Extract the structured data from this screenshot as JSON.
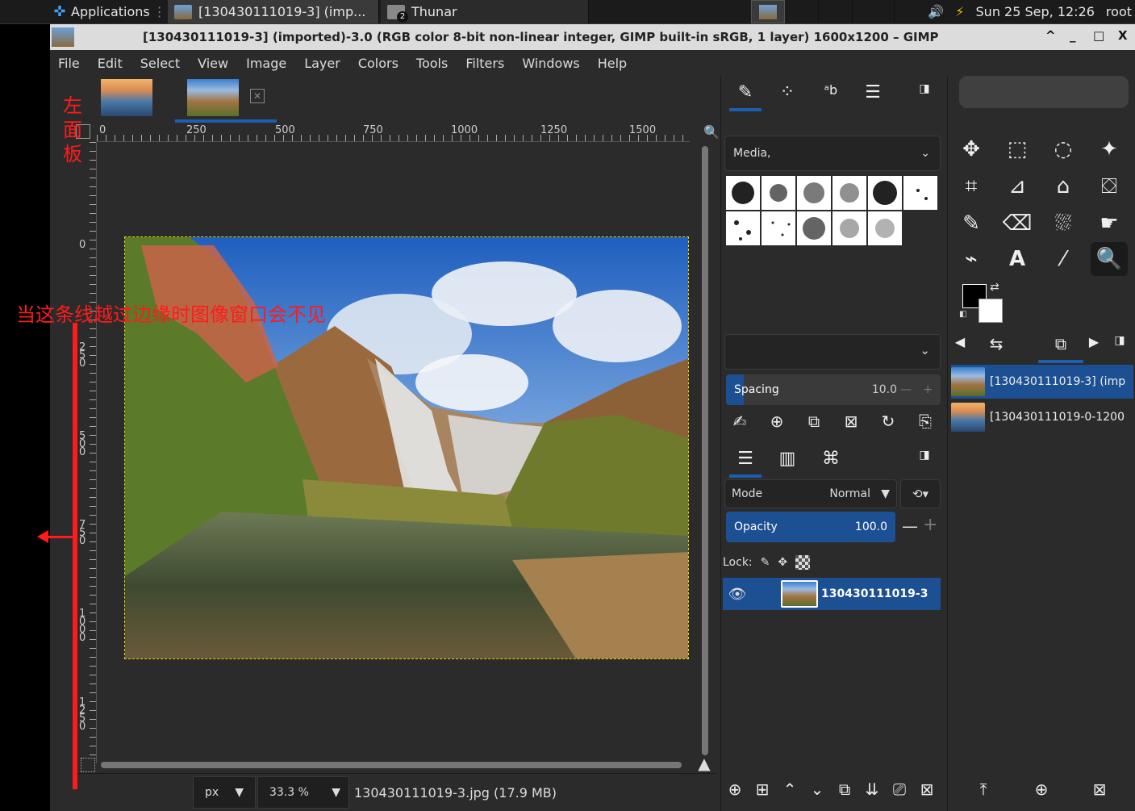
{
  "system_panel": {
    "apps_label": "Applications",
    "task_gimp": "[130430111019-3] (imp...",
    "task_thunar": "Thunar",
    "thunar_badge": "2",
    "clock": "Sun 25 Sep, 12:26",
    "user": "root"
  },
  "window": {
    "title": "[130430111019-3] (imported)-3.0 (RGB color 8-bit non-linear integer, GIMP built-in sRGB, 1 layer) 1600x1200 – GIMP",
    "btn_up": "^",
    "btn_min": "_",
    "btn_max": "□",
    "btn_close": "X"
  },
  "menu": [
    "File",
    "Edit",
    "Select",
    "View",
    "Image",
    "Layer",
    "Colors",
    "Tools",
    "Filters",
    "Windows",
    "Help"
  ],
  "ruler": {
    "h_ticks": [
      "0",
      "250",
      "500",
      "750",
      "1000",
      "1250",
      "1500"
    ],
    "v_ticks": [
      "0",
      "250",
      "500",
      "750",
      "1000",
      "1250"
    ]
  },
  "statusbar": {
    "unit": "px",
    "zoom": "33.3 %",
    "file_info": "130430111019-3.jpg (17.9 MB)"
  },
  "brushes": {
    "preset_label": "Media,",
    "spacing_label": "Spacing",
    "spacing_value": "10.0"
  },
  "layers": {
    "mode_label": "Mode",
    "mode_value": "Normal",
    "opacity_label": "Opacity",
    "opacity_value": "100.0",
    "lock_label": "Lock:",
    "layer_name": "130430111019-3"
  },
  "images_list": [
    {
      "name": "[130430111019-3] (imp"
    },
    {
      "name": "[130430111019-0-1200"
    }
  ],
  "annotations": {
    "left_panel": "左面板",
    "line_note": "当这条线越过边缘时图像窗口会不见"
  },
  "colors": {
    "accent_blue": "#1d4f93",
    "annotation_red": "#ff1b1b",
    "selection_yellow": "#e6d600"
  }
}
